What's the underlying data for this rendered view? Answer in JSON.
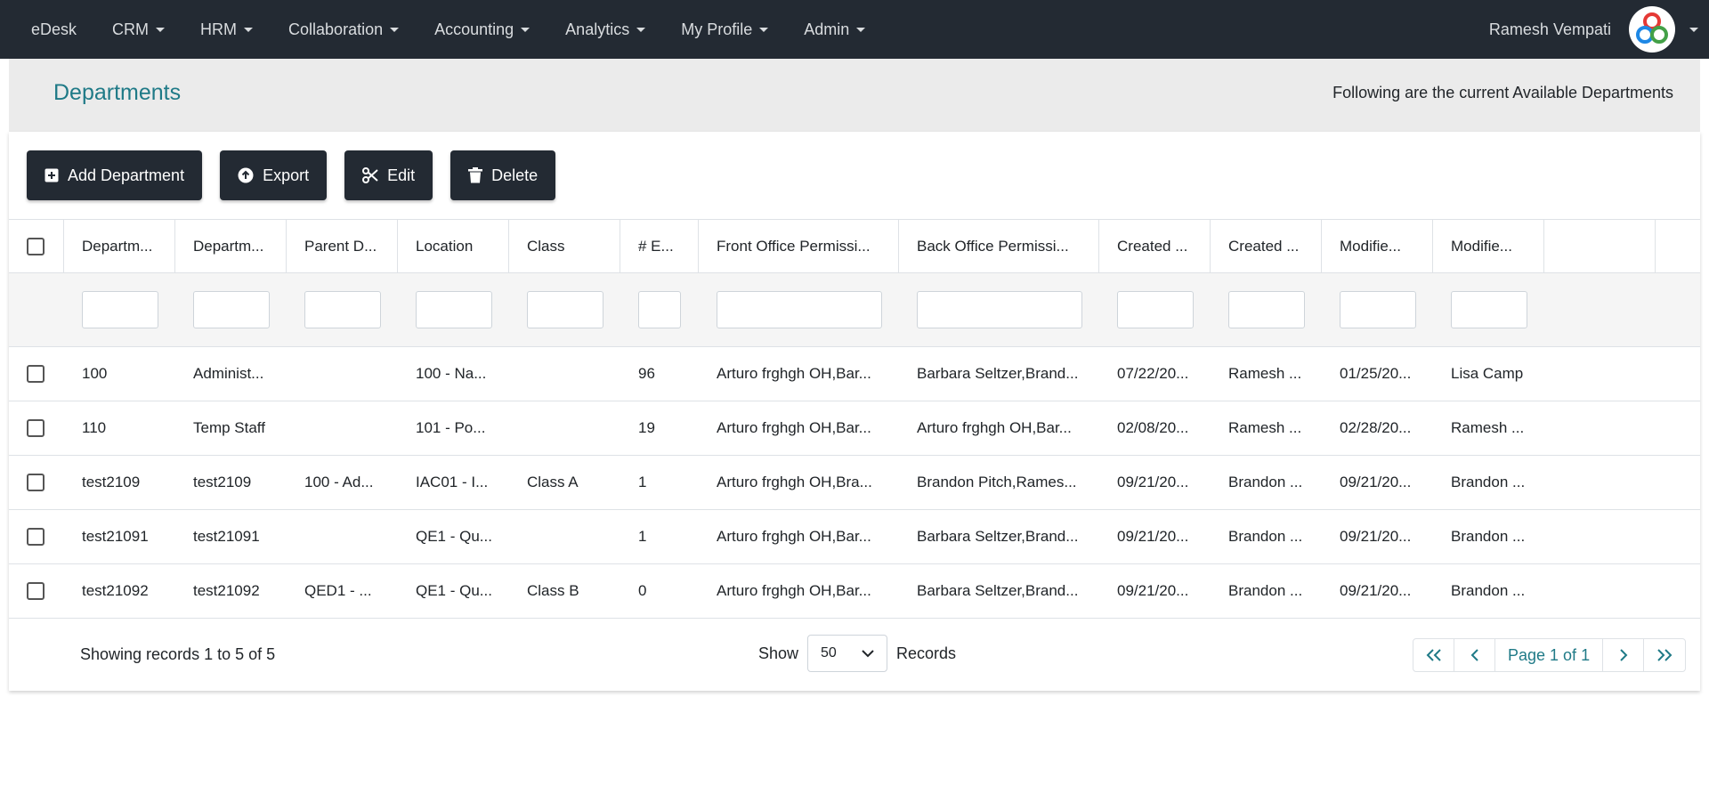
{
  "nav": {
    "items": [
      {
        "label": "eDesk",
        "caret": false
      },
      {
        "label": "CRM",
        "caret": true
      },
      {
        "label": "HRM",
        "caret": true
      },
      {
        "label": "Collaboration",
        "caret": true
      },
      {
        "label": "Accounting",
        "caret": true
      },
      {
        "label": "Analytics",
        "caret": true
      },
      {
        "label": "My Profile",
        "caret": true
      },
      {
        "label": "Admin",
        "caret": true
      }
    ],
    "user_name": "Ramesh Vempati"
  },
  "header": {
    "title": "Departments",
    "subtitle": "Following are the current Available Departments"
  },
  "toolbar": {
    "add_label": "Add Department",
    "export_label": "Export",
    "edit_label": "Edit",
    "delete_label": "Delete"
  },
  "table": {
    "columns": [
      "Departm...",
      "Departm...",
      "Parent D...",
      "Location",
      "Class",
      "# E...",
      "Front Office Permissi...",
      "Back Office Permissi...",
      "Created ...",
      "Created ...",
      "Modifie...",
      "Modifie...",
      "",
      ""
    ],
    "rows": [
      [
        "100",
        "Administ...",
        "",
        "100 - Na...",
        "",
        "96",
        "Arturo frghgh OH,Bar...",
        "Barbara Seltzer,Brand...",
        "07/22/20...",
        "Ramesh ...",
        "01/25/20...",
        "Lisa Camp",
        "",
        ""
      ],
      [
        "110",
        "Temp Staff",
        "",
        "101 - Po...",
        "",
        "19",
        "Arturo frghgh OH,Bar...",
        "Arturo frghgh OH,Bar...",
        "02/08/20...",
        "Ramesh ...",
        "02/28/20...",
        "Ramesh ...",
        "",
        ""
      ],
      [
        "test2109",
        "test2109",
        "100 - Ad...",
        "IAC01 - I...",
        "Class A",
        "1",
        "Arturo frghgh OH,Bra...",
        "Brandon Pitch,Rames...",
        "09/21/20...",
        "Brandon ...",
        "09/21/20...",
        "Brandon ...",
        "",
        ""
      ],
      [
        "test21091",
        "test21091",
        "",
        "QE1 - Qu...",
        "",
        "1",
        "Arturo frghgh OH,Bar...",
        "Barbara Seltzer,Brand...",
        "09/21/20...",
        "Brandon ...",
        "09/21/20...",
        "Brandon ...",
        "",
        ""
      ],
      [
        "test21092",
        "test21092",
        "QED1 - ...",
        "QE1 - Qu...",
        "Class B",
        "0",
        "Arturo frghgh OH,Bar...",
        "Barbara Seltzer,Brand...",
        "09/21/20...",
        "Brandon ...",
        "09/21/20...",
        "Brandon ...",
        "",
        ""
      ]
    ]
  },
  "footer": {
    "records_info": "Showing records 1 to 5 of 5",
    "show_label": "Show",
    "page_size": "50",
    "records_label": "Records",
    "page_label": "Page 1 of 1"
  },
  "colors": {
    "nav_bg": "#232a33",
    "accent": "#1f7a87",
    "header_band": "#ebebeb"
  }
}
